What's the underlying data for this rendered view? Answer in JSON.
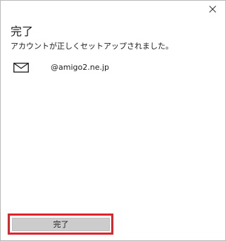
{
  "dialog": {
    "title": "完了",
    "message": "アカウントが正しくセットアップされました。",
    "close_icon": "close-icon"
  },
  "account": {
    "icon": "mail-icon",
    "email": "@amigo2.ne.jp"
  },
  "footer": {
    "done_label": "完了",
    "highlight_color": "#e0232a"
  }
}
